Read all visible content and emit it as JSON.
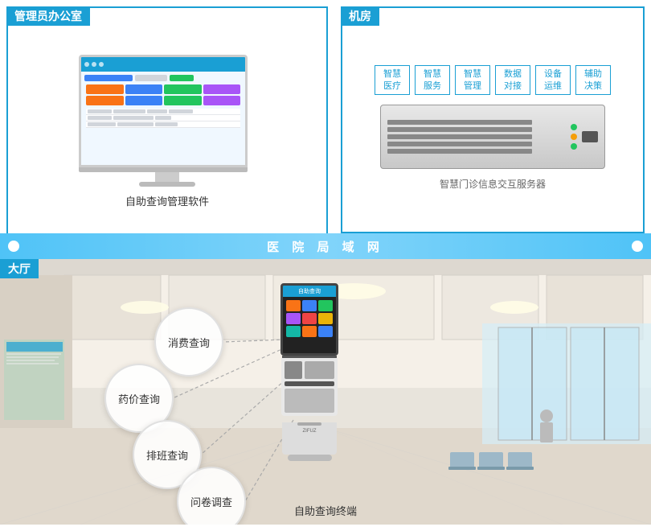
{
  "admin_section": {
    "label": "管理员办公室",
    "sublabel": "自助查询管理软件"
  },
  "machine_section": {
    "label": "机房",
    "sublabel": "智慧门诊信息交互服务器",
    "categories": [
      {
        "line1": "智慧",
        "line2": "医疗"
      },
      {
        "line1": "智慧",
        "line2": "服务"
      },
      {
        "line1": "智慧",
        "line2": "管理"
      },
      {
        "line1": "数据",
        "line2": "对接"
      },
      {
        "line1": "设备",
        "line2": "运维"
      },
      {
        "line1": "辅助",
        "line2": "决策"
      }
    ]
  },
  "network": {
    "label": "医 院 局 域 网"
  },
  "lobby": {
    "label": "大厅",
    "bubbles": [
      {
        "text": "消费查询"
      },
      {
        "text": "药价查询"
      },
      {
        "text": "排班查询"
      },
      {
        "text": "问卷调查"
      }
    ],
    "kiosk_label": "自助查询终端",
    "kiosk_screen_title": "自助查询"
  }
}
